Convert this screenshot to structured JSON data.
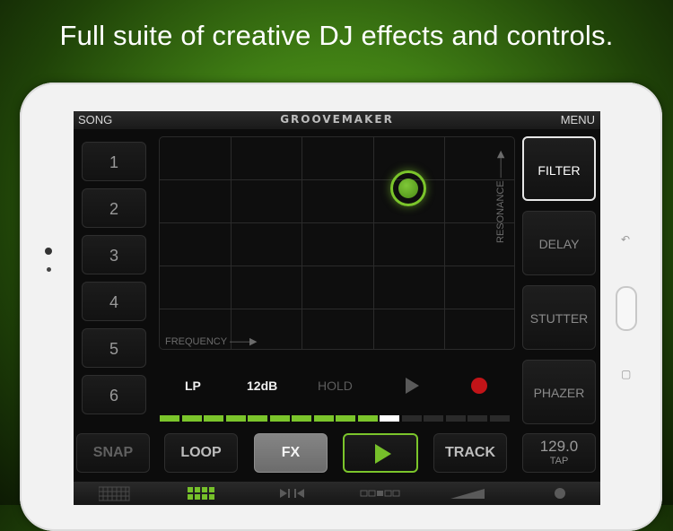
{
  "headline": "Full suite of creative DJ effects and controls.",
  "app": {
    "topbar": {
      "left": "SONG",
      "logo": "GROOVEMAKER",
      "right": "MENU"
    },
    "slots": [
      "1",
      "2",
      "3",
      "4",
      "5",
      "6"
    ],
    "pad": {
      "x_label": "FREQUENCY",
      "y_label": "RESONANCE"
    },
    "filter_controls": {
      "type": "LP",
      "slope": "12dB",
      "hold": "HOLD"
    },
    "meter": {
      "active_segments": 11,
      "total_segments": 16
    },
    "fx_buttons": [
      "FILTER",
      "DELAY",
      "STUTTER",
      "PHAZER"
    ],
    "active_fx": "FILTER",
    "bottom_buttons": {
      "snap": "SNAP",
      "loop": "LOOP",
      "fx": "FX",
      "track": "TRACK"
    },
    "tempo": {
      "bpm": "129.0",
      "tap": "TAP"
    },
    "bottom_tabs": [
      "grid-view-icon",
      "pads-view-icon",
      "mixer-icon",
      "sequence-icon",
      "volume-ramp-icon",
      "record-dot-icon"
    ],
    "accent_color": "#7bc52b"
  }
}
